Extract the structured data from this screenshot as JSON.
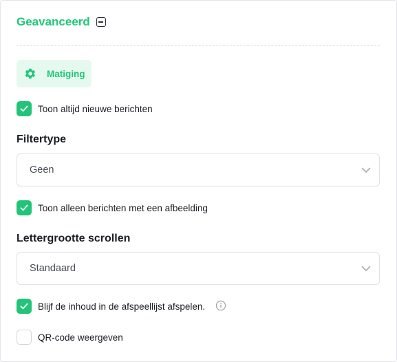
{
  "section": {
    "title": "Geavanceerd"
  },
  "tab": {
    "label": "Matiging",
    "icon": "gear-icon"
  },
  "options": {
    "always_show_new": {
      "label": "Toon altijd nieuwe berichten",
      "checked": true
    },
    "only_with_image": {
      "label": "Toon alleen berichten met een afbeelding",
      "checked": true
    },
    "keep_playing": {
      "label": "Blijf de inhoud in de afspeellijst afspelen.",
      "checked": true
    },
    "show_qr": {
      "label": "QR-code weergeven",
      "checked": false
    }
  },
  "filter_type": {
    "label": "Filtertype",
    "value": "Geen"
  },
  "font_size_scroll": {
    "label": "Lettergrootte scrollen",
    "value": "Standaard"
  },
  "colors": {
    "accent": "#1ec77a",
    "checkbox": "#22c47a",
    "chip_bg": "#e6f9ef"
  }
}
